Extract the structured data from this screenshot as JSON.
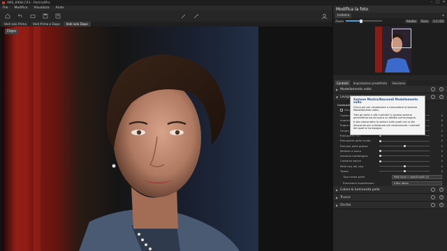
{
  "window": {
    "title": "ANS_6908.CR3 - PortraitPro"
  },
  "menu": [
    "File",
    "Modifica",
    "Visualizza",
    "Aiuto"
  ],
  "view_tabs": [
    "Vedi solo Prima",
    "Vedi Prima e Dopo",
    "Vedi solo Dopo"
  ],
  "canvas": {
    "badge": "Dopo"
  },
  "panel": {
    "title": "Modifica la foto",
    "undo_label": "Indietro",
    "zoom_label": "Zoom",
    "zoom_value_fraction": 0.42,
    "zoom_buttons": [
      "Adatta",
      "Fisso",
      "1:1 (10"
    ],
    "tabs": [
      "Controlli",
      "Impostazioni predefinite",
      "Selezione"
    ],
    "sections_top": [
      "Modellamento volto",
      "Levigatura pelle"
    ]
  },
  "tooltip": {
    "title": "Sezione Mostra/Nascondi Modellamento volto",
    "p1": "Clicca qui per visualizzare o nascondere la sezione Modellamento volto.",
    "p2": "Tutti gli slider e altri controlli in questa sezione permetteranno ad avere un effetto sull'immagine.",
    "p3": "Il sito nascondere le sezioni sulle quali non si sta lavorando per individuare più velocemente i controlli dei quali si ha bisogno."
  },
  "sliders_header": "Controlli",
  "visual_check": "Visualizza",
  "sliders": [
    {
      "label": "Contorni",
      "value": 0.46,
      "val": "0"
    },
    {
      "label": "Imperfezioni",
      "value": 0.46,
      "val": "0"
    },
    {
      "label": "Rughe sottili",
      "value": 0.02,
      "val": "0"
    },
    {
      "label": "Ombre Pori",
      "value": 0.02,
      "val": "0"
    },
    {
      "label": "Rimuovere Pori",
      "value": 0.02,
      "val": "0"
    },
    {
      "label": "Rimuovere pelle lucida",
      "value": 0.02,
      "val": "0"
    },
    {
      "label": "Rimuovi pelle grassa",
      "value": 0.5,
      "val": "0"
    },
    {
      "label": "Mettere a fuoco",
      "value": 0.02,
      "val": "0"
    },
    {
      "label": "Armonia morfologica",
      "value": 0.02,
      "val": "0"
    },
    {
      "label": "Contorno bocca",
      "value": 0.02,
      "val": "0"
    },
    {
      "label": "Pelle non del viso",
      "value": 0.5,
      "val": "0"
    },
    {
      "label": "Trama",
      "value": 0.5,
      "val": "0"
    }
  ],
  "selects": [
    {
      "label": "Tipo trama pelle",
      "value": "Pelle liscia + capelli sciolti (1)"
    },
    {
      "label": "Rimozione imperfezioni",
      "value": "Il Blur attivo"
    }
  ],
  "sections_bottom": [
    "Colore & luminosità pelle",
    "Trucco",
    "Occhio"
  ]
}
